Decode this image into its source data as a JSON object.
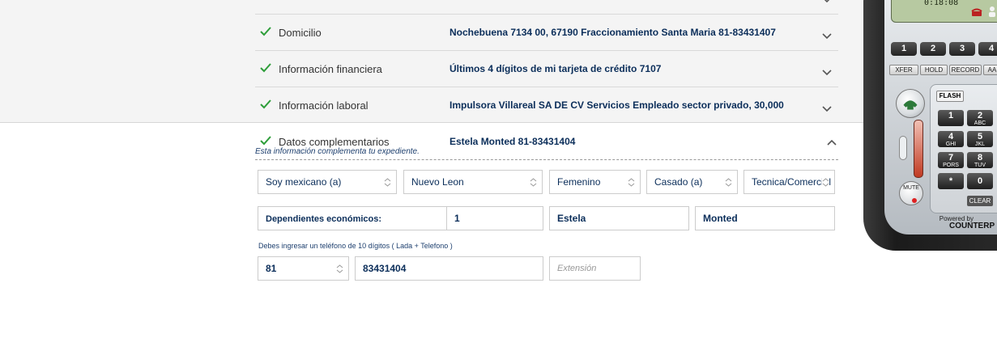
{
  "rows": [
    {
      "label": "Domicilio",
      "value": "Nochebuena 7134 00, 67190 Fraccionamiento Santa Maria 81-83431407"
    },
    {
      "label": "Información financiera",
      "value": "Últimos 4 dígitos de mi tarjeta de crédito 7107"
    },
    {
      "label": "Información laboral",
      "value": "Impulsora Villareal SA DE CV Servicios Empleado sector privado, 30,000"
    }
  ],
  "expanded": {
    "label": "Datos complementarios",
    "value": "Estela Monted 81-83431404",
    "hint": "Esta información complementa tu expediente."
  },
  "selects": {
    "nationality": "Soy mexicano (a)",
    "state": "Nuevo Leon",
    "gender": "Femenino",
    "marital": "Casado (a)",
    "education": "Tecnica/Comercial"
  },
  "dependents": {
    "label": "Dependientes económicos:",
    "value": "1",
    "first_name": "Estela",
    "last_name": "Monted"
  },
  "phone": {
    "note": "Debes ingresar un teléfono de 10 dígitos ( Lada + Telefono )",
    "lada": "81",
    "number": "83431404",
    "extension_placeholder": "Extensión"
  },
  "softphone": {
    "time": "0:18:08",
    "lines": [
      "1",
      "2",
      "3",
      "4"
    ],
    "buttons": [
      "XFER",
      "HOLD",
      "RECORD",
      "AA"
    ],
    "flash": "FLASH",
    "keys": [
      {
        "d": "1",
        "s": ""
      },
      {
        "d": "2",
        "s": "ABC"
      },
      {
        "d": "4",
        "s": "GHI"
      },
      {
        "d": "5",
        "s": "JKL"
      },
      {
        "d": "7",
        "s": "PORS"
      },
      {
        "d": "8",
        "s": "TUV"
      },
      {
        "d": "*",
        "s": ""
      },
      {
        "d": "0",
        "s": ""
      }
    ],
    "mute": "MUTE",
    "clear": "CLEAR",
    "powered": "Powered by",
    "brand": "COUNTERP"
  },
  "colors": {
    "accent": "#0b2e5a",
    "check": "#2e9e3a"
  }
}
